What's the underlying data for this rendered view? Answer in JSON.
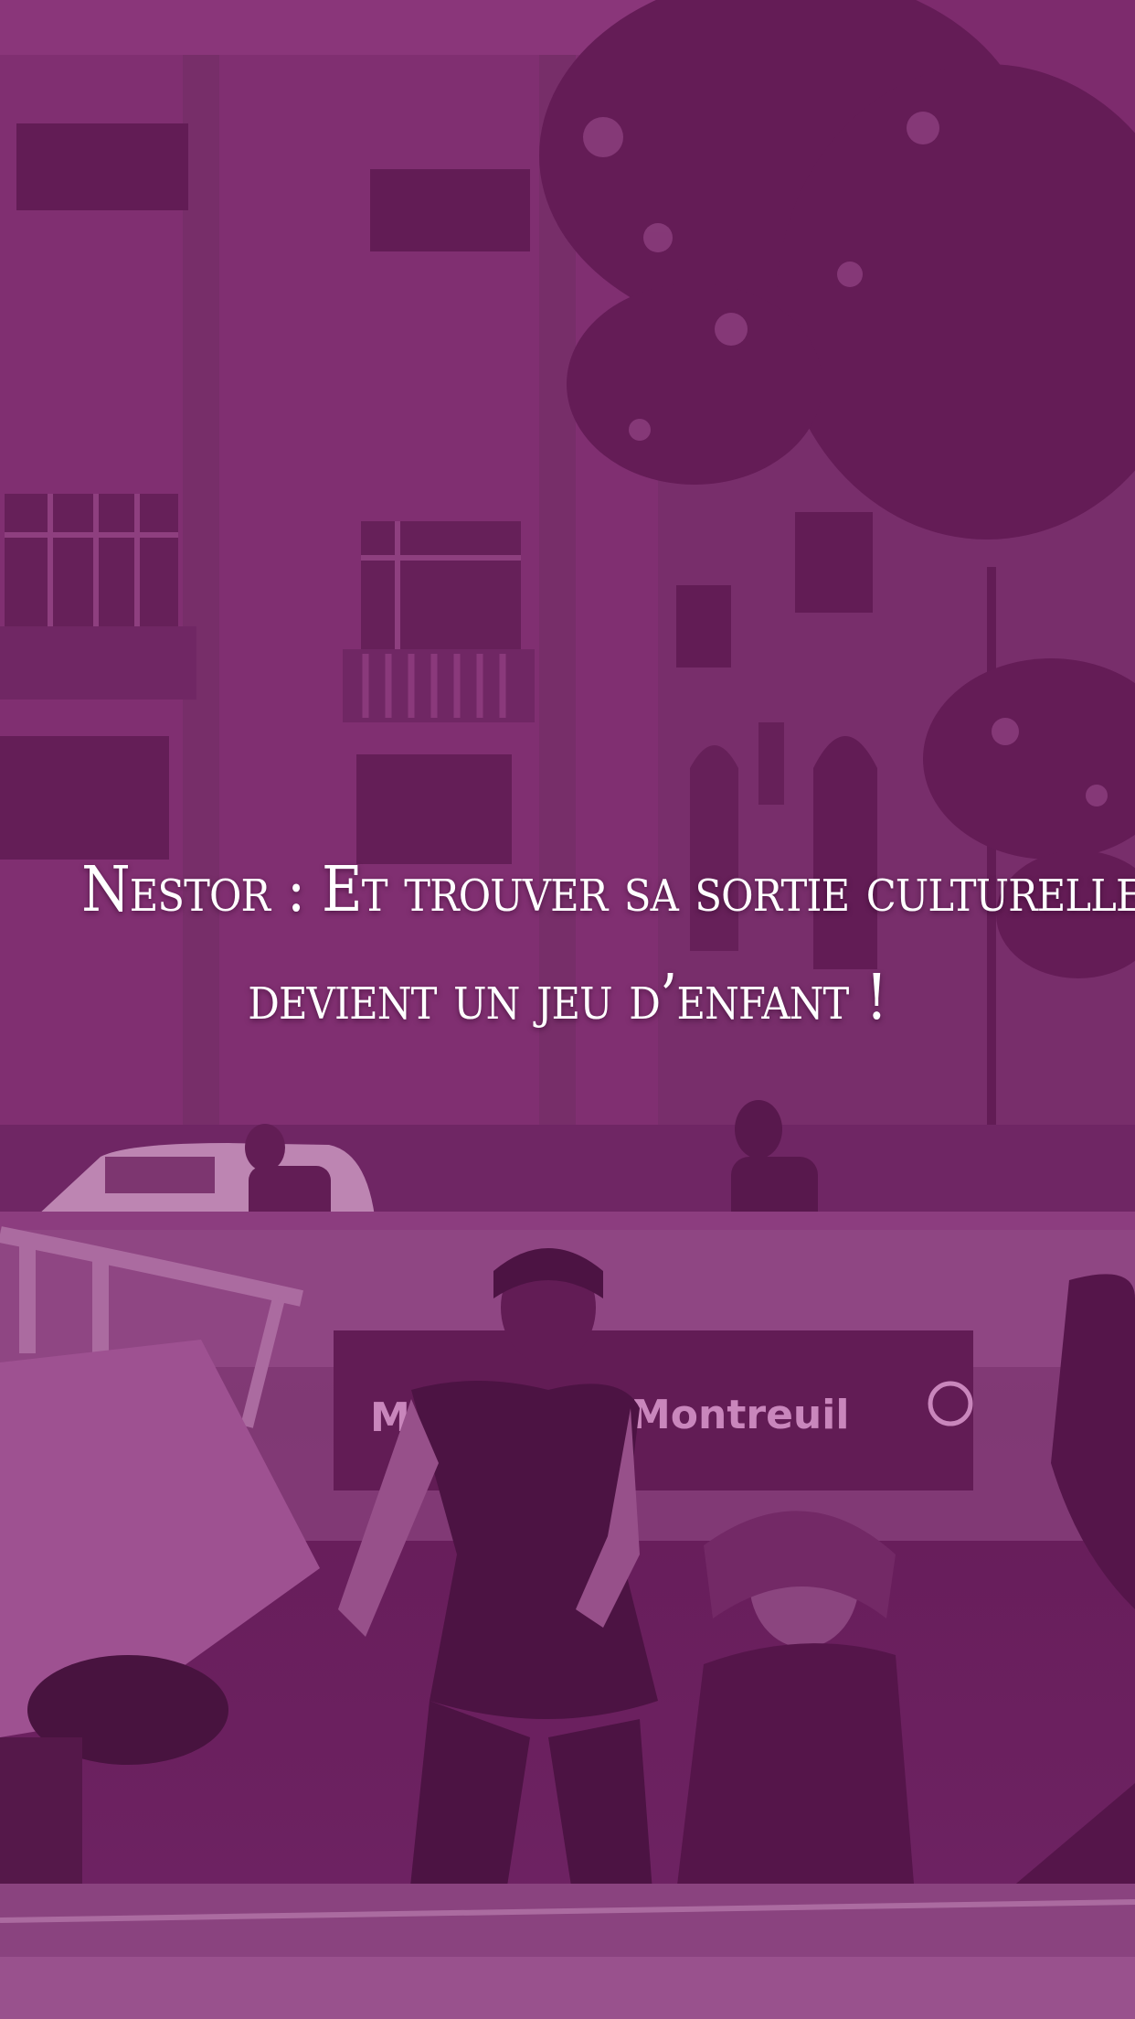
{
  "headline": {
    "line1": "Nestor : Et trouver sa sortie culturelle",
    "line2": "devient un jeu d’enfant !"
  },
  "background": {
    "metro_sign": "Montreuil",
    "metro_sign_prefix": "M"
  },
  "colors": {
    "overlay_tint": "#8c2878",
    "text": "#ffffff"
  }
}
